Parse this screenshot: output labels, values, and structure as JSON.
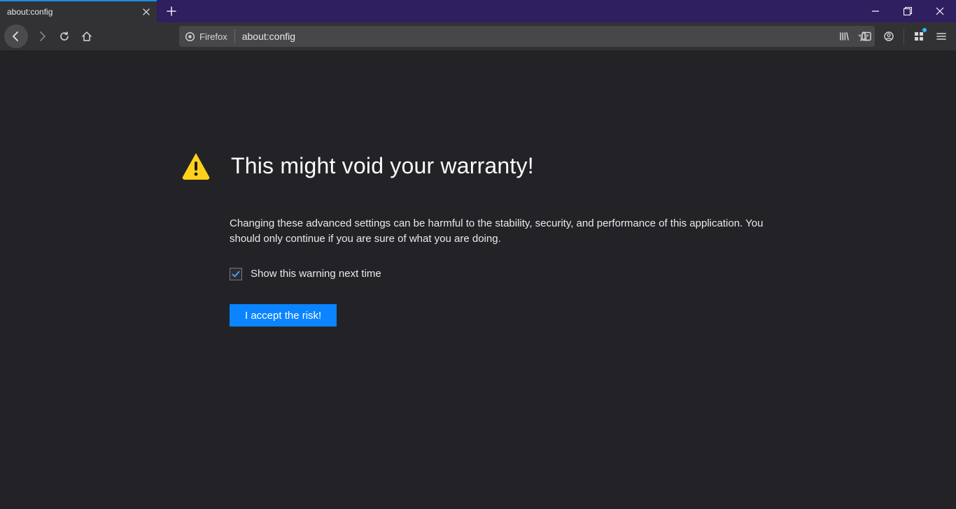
{
  "tab": {
    "title": "about:config"
  },
  "urlbar": {
    "identity_label": "Firefox",
    "url": "about:config"
  },
  "warning": {
    "title": "This might void your warranty!",
    "body": "Changing these advanced settings can be harmful to the stability, security, and performance of this application. You should only continue if you are sure of what you are doing.",
    "checkbox_label": "Show this warning next time",
    "checkbox_checked": true,
    "accept_label": "I accept the risk!"
  }
}
